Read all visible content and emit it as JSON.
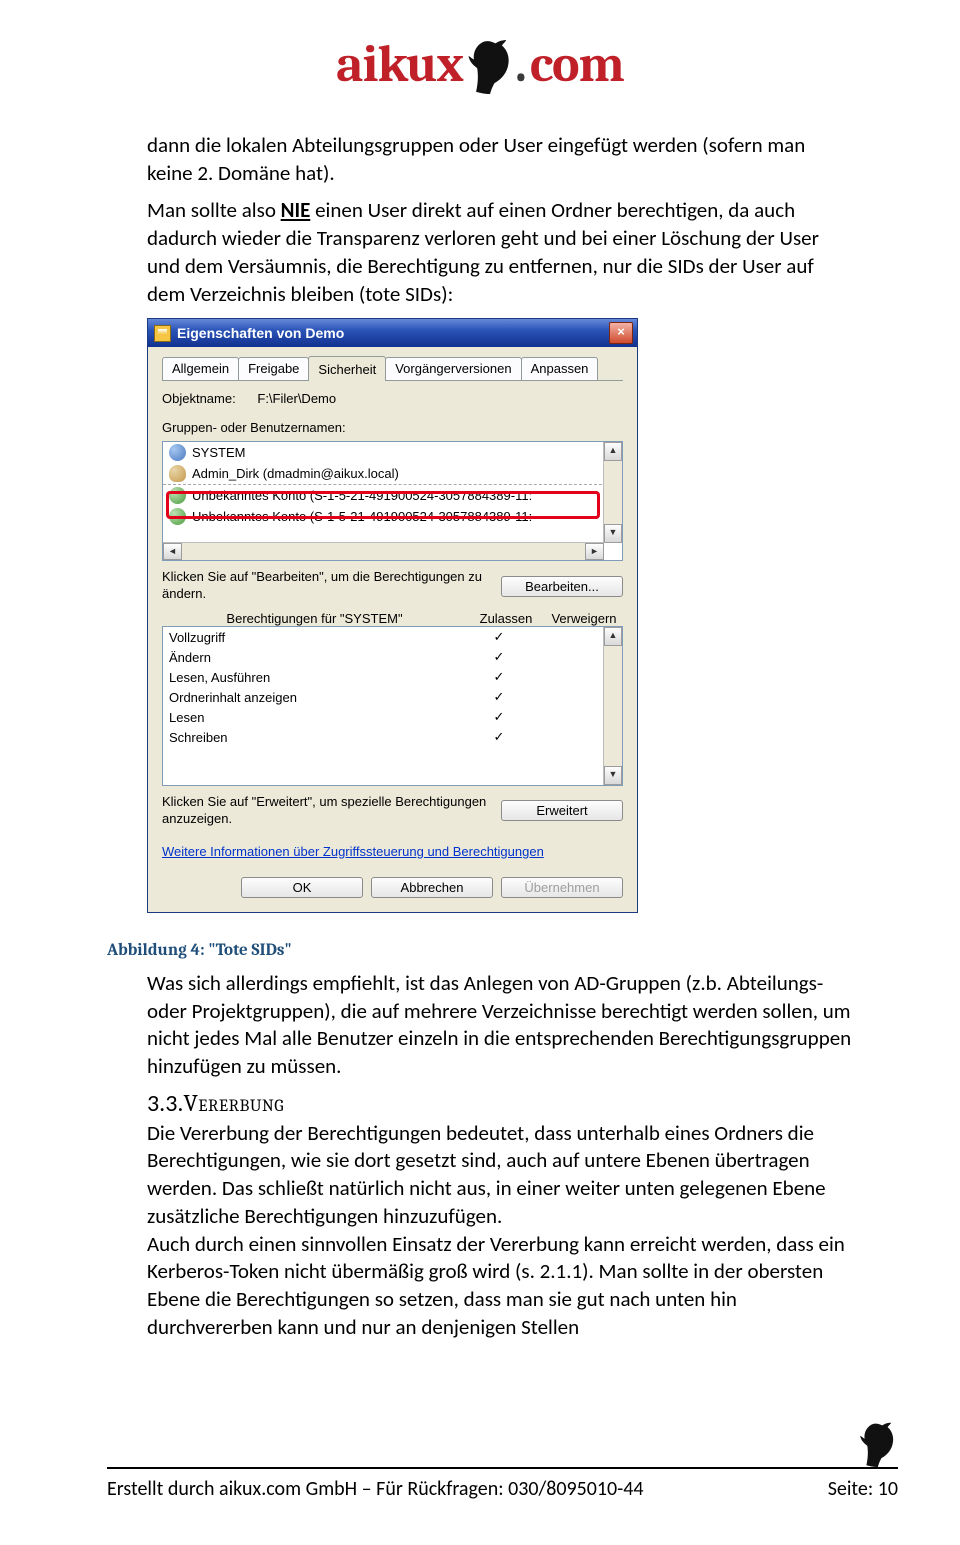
{
  "logo": {
    "left": "aikux",
    "dot": ".",
    "right": "com"
  },
  "para1": "dann die lokalen Abteilungsgruppen oder User eingefügt werden (sofern man keine 2. Domäne hat).",
  "para2a": "Man sollte also ",
  "para2_nie": "NIE",
  "para2b": " einen User direkt auf einen Ordner berechtigen, da auch dadurch wieder die Transparenz verloren geht und bei einer Löschung der User und dem Versäumnis, die Berechtigung zu entfernen, nur die SIDs der User auf dem Verzeichnis bleiben (tote SIDs):",
  "win": {
    "title": "Eigenschaften von Demo",
    "tabs": [
      "Allgemein",
      "Freigabe",
      "Sicherheit",
      "Vorgängerversionen",
      "Anpassen"
    ],
    "objlabel": "Objektname:",
    "objval": "F:\\Filer\\Demo",
    "gblabel": "Gruppen- oder Benutzernamen:",
    "users": [
      {
        "t": "SYSTEM",
        "k": "grp"
      },
      {
        "t": "Admin_Dirk  (dmadmin@aikux.local)",
        "k": "usr"
      },
      {
        "t": "Unbekanntes Konto (S-1-5-21-491900524-3057884389-11:",
        "k": "unk"
      },
      {
        "t": "Unbekanntes Konto (S-1-5-21-491900524-3057884389-11:",
        "k": "unk"
      }
    ],
    "editText": "Klicken Sie auf \"Bearbeiten\", um die Berechtigungen zu ändern.",
    "editBtn": "Bearbeiten...",
    "permFor": "Berechtigungen für \"SYSTEM\"",
    "allow": "Zulassen",
    "deny": "Verweigern",
    "perms": [
      {
        "n": "Vollzugriff",
        "a": true
      },
      {
        "n": "Ändern",
        "a": true
      },
      {
        "n": "Lesen, Ausführen",
        "a": true
      },
      {
        "n": "Ordnerinhalt anzeigen",
        "a": true
      },
      {
        "n": "Lesen",
        "a": true
      },
      {
        "n": "Schreiben",
        "a": true
      }
    ],
    "advText": "Klicken Sie auf \"Erweitert\", um spezielle Berechtigungen anzuzeigen.",
    "advBtn": "Erweitert",
    "link": "Weitere Informationen über Zugriffssteuerung und Berechtigungen",
    "ok": "OK",
    "cancel": "Abbrechen",
    "apply": "Übernehmen"
  },
  "caption": "Abbildung 4: \"Tote SIDs\"",
  "para3": "Was sich allerdings empfiehlt, ist das Anlegen von AD-Gruppen (z.b. Abteilungs- oder Projektgruppen), die auf mehrere Verzeichnisse berechtigt werden sollen, um nicht jedes Mal alle Benutzer einzeln in die entsprechenden Berechtigungsgruppen hinzufügen zu müssen.",
  "h3num": "3.3.",
  "h3txt": "Vererbung",
  "para4": "Die Vererbung der Berechtigungen bedeutet, dass unterhalb eines Ordners die Berechtigungen, wie sie dort gesetzt sind, auch auf untere Ebenen übertragen werden. Das schließt natürlich nicht aus, in einer weiter unten gelegenen Ebene zusätzliche Berechtigungen hinzuzufügen.",
  "para5": "Auch durch einen sinnvollen Einsatz der Vererbung kann erreicht werden, dass ein Kerberos-Token nicht übermäßig groß wird (s. 2.1.1). Man sollte in der obersten Ebene die Berechtigungen so setzen, dass man sie gut nach unten hin durchvererben kann und nur an denjenigen Stellen",
  "footer": {
    "left": "Erstellt durch aikux.com GmbH – Für Rückfragen: 030/8095010-44",
    "right": "Seite: 10"
  }
}
